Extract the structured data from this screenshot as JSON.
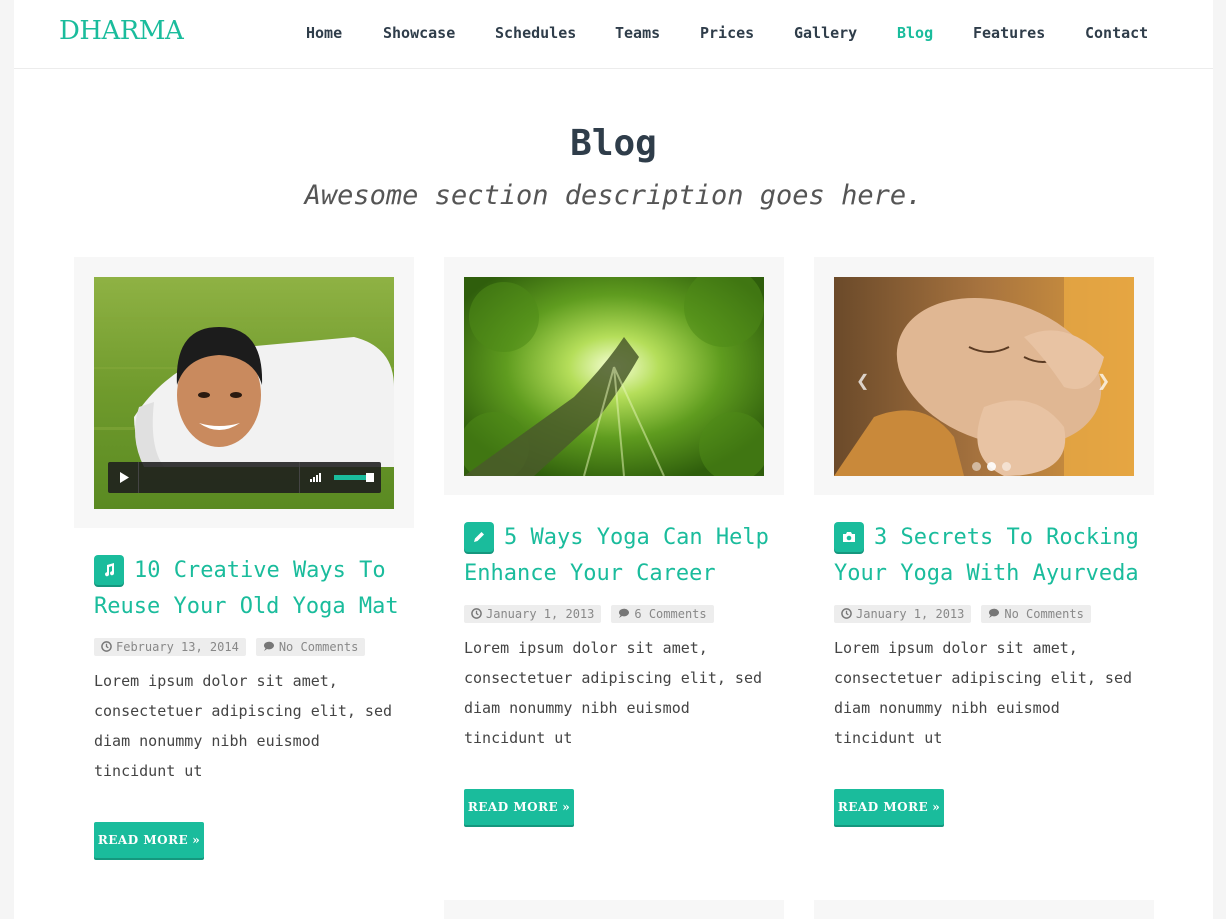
{
  "header": {
    "brand": "DHARMA",
    "nav": [
      {
        "label": "Home",
        "active": false
      },
      {
        "label": "Showcase",
        "active": false
      },
      {
        "label": "Schedules",
        "active": false
      },
      {
        "label": "Teams",
        "active": false
      },
      {
        "label": "Prices",
        "active": false
      },
      {
        "label": "Gallery",
        "active": false
      },
      {
        "label": "Blog",
        "active": true
      },
      {
        "label": "Features",
        "active": false
      },
      {
        "label": "Contact",
        "active": false
      }
    ]
  },
  "section": {
    "title": "Blog",
    "description": "Awesome section description goes here."
  },
  "posts": [
    {
      "format_icon": "music-icon",
      "title_line1": "10 Creative Ways To",
      "title_line2": "Reuse Your Old Yoga Mat",
      "date": "February 13, 2014",
      "comments": "No Comments",
      "excerpt_lines": [
        "Lorem ipsum dolor sit amet,",
        "consectetuer adipiscing elit, sed",
        "diam nonummy nibh euismod",
        "tincidunt ut"
      ],
      "read_more": "READ MORE",
      "media": "audio-player"
    },
    {
      "format_icon": "pencil-icon",
      "title_line1": "5 Ways Yoga Can Help",
      "title_line2": "Enhance Your Career",
      "date": "January 1, 2013",
      "comments": "6 Comments",
      "excerpt_lines": [
        "Lorem ipsum dolor sit amet,",
        "consectetuer adipiscing elit, sed",
        "diam nonummy nibh euismod",
        "tincidunt ut"
      ],
      "read_more": "READ MORE",
      "media": "image"
    },
    {
      "format_icon": "camera-icon",
      "title_line1": "3 Secrets To Rocking",
      "title_line2": "Your Yoga With Ayurveda",
      "date": "January 1, 2013",
      "comments": "No Comments",
      "excerpt_lines": [
        "Lorem ipsum dolor sit amet,",
        "consectetuer adipiscing elit, sed",
        "diam nonummy nibh euismod",
        "tincidunt ut"
      ],
      "read_more": "READ MORE",
      "media": "gallery-carousel"
    }
  ],
  "colors": {
    "accent": "#1abc9c",
    "heading": "#2f3d4a",
    "meta_bg": "#ededed"
  }
}
